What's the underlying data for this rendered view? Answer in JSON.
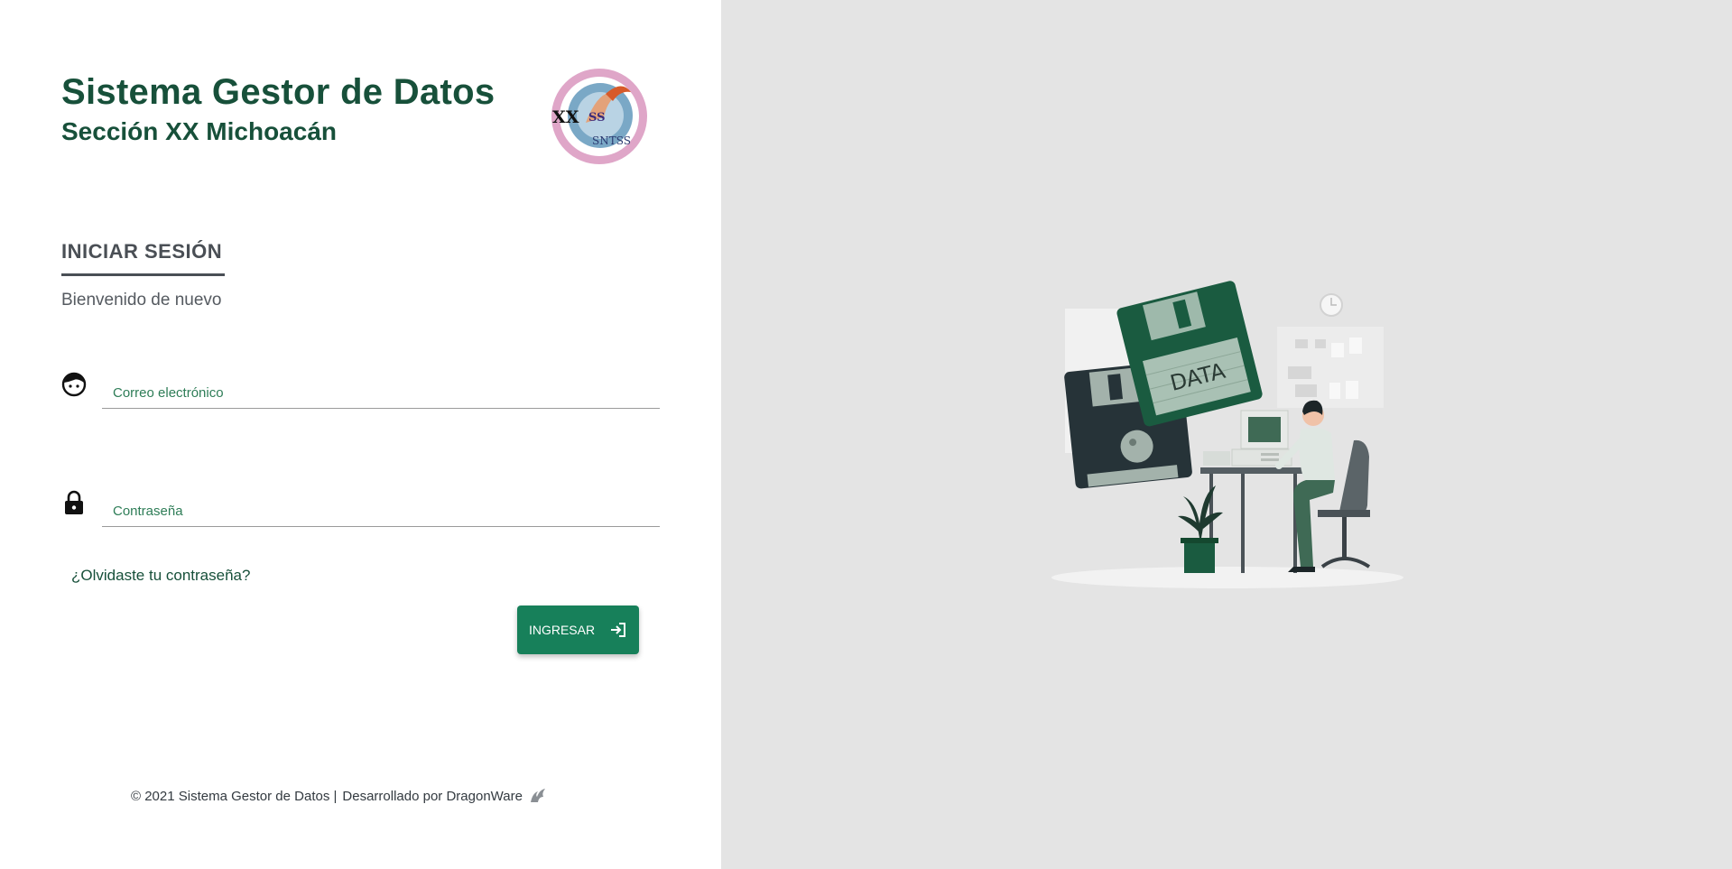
{
  "header": {
    "title": "Sistema Gestor de Datos",
    "subtitle": "Sección XX Michoacán",
    "logo_text": "SNTSS"
  },
  "login": {
    "heading": "INICIAR SESIÓN",
    "welcome": "Bienvenido de nuevo",
    "email_placeholder": "Correo electrónico",
    "password_placeholder": "Contraseña",
    "forgot_link": "¿Olvidaste tu contraseña?",
    "submit_label": "INGRESAR"
  },
  "footer": {
    "copyright": "© 2021 Sistema Gestor de Datos |",
    "developer": "Desarrollado por DragonWare"
  },
  "illustration": {
    "floppy_label": "DATA"
  },
  "icons": {
    "email": "face-icon",
    "password": "lock-icon",
    "submit": "login-icon",
    "footer": "dragon-icon"
  },
  "colors": {
    "primary": "#17805a",
    "title": "#17503a",
    "right_panel_bg": "#e4e4e4"
  }
}
